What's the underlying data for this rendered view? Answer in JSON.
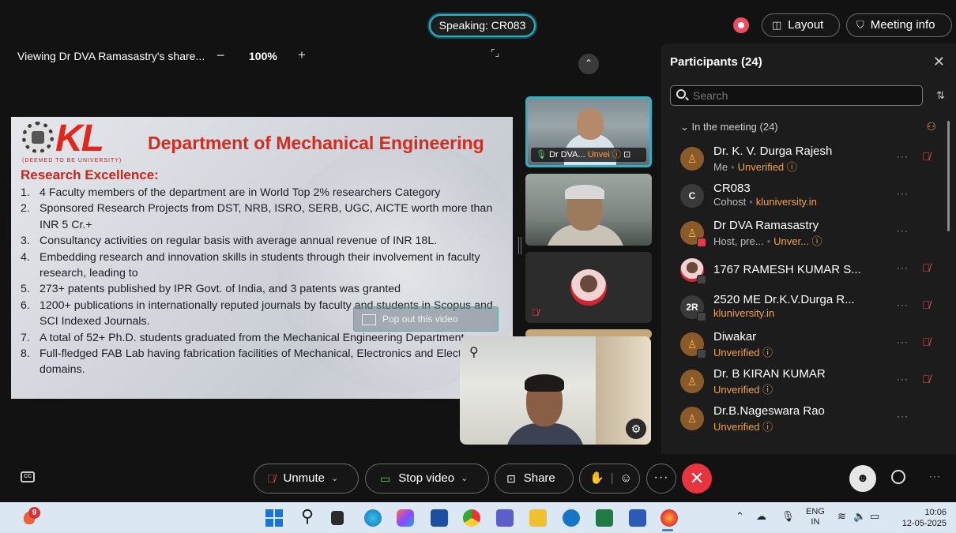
{
  "top": {
    "speaking": "Speaking: CR083",
    "layout_label": "Layout",
    "meeting_info_label": "Meeting info"
  },
  "share_bar": {
    "viewing": "Viewing Dr DVA Ramasastry's share...",
    "zoom_out": "−",
    "zoom_level": "100%",
    "zoom_in": "+"
  },
  "slide": {
    "logo_text": "KL",
    "logo_university": "(DEEMED TO BE UNIVERSITY)",
    "title": "Department of Mechanical Engineering",
    "subtitle": "Research Excellence:",
    "items": [
      {
        "n": "1.",
        "text": "4 Faculty members of the department are in World Top 2% researchers Category"
      },
      {
        "n": "2.",
        "text": "Sponsored Research Projects from DST, NRB, ISRO, SERB, UGC, AICTE worth more than INR 5 Cr.+"
      },
      {
        "n": "3.",
        "text": "Consultancy activities on regular basis with average annual revenue of INR 18L."
      },
      {
        "n": "4.",
        "text": "Embedding research and innovation skills in students through their involvement in faculty research, leading to"
      },
      {
        "n": "5.",
        "text": "273+ patents published by IPR Govt. of India, and 3 patents was granted"
      },
      {
        "n": "6.",
        "text": "1200+ publications in internationally reputed journals by faculty and students in Scopus and SCI Indexed Journals."
      },
      {
        "n": "7.",
        "text": "A total of 52+ Ph.D. students graduated from the Mechanical Engineering Department."
      },
      {
        "n": "8.",
        "text": "Full-fledged FAB Lab having fabrication facilities of Mechanical, Electronics and Electrical domains."
      }
    ],
    "popout": "Pop out this video"
  },
  "tiles": {
    "tile1_name": "Dr DVA...",
    "tile1_status": "Unvei"
  },
  "panel": {
    "title": "Participants (24)",
    "search_placeholder": "Search",
    "in_meeting": "In the meeting (24)",
    "participants": [
      {
        "name": "Dr. K. V. Durga Rajesh",
        "role": "Me",
        "status": "Unverified ⓘ",
        "initials": "",
        "muted": true
      },
      {
        "name": "CR083",
        "role": "Cohost",
        "status": "kluniversity.in",
        "initials": "C",
        "muted": false
      },
      {
        "name": "Dr DVA Ramasastry",
        "role": "Host, pre...",
        "status": "Unver... ⓘ",
        "initials": "",
        "muted": false
      },
      {
        "name": "1767 RAMESH KUMAR S...",
        "role": "",
        "status": "",
        "initials": "",
        "muted": true
      },
      {
        "name": "2520 ME Dr.K.V.Durga R...",
        "role": "",
        "status": "kluniversity.in",
        "initials": "2R",
        "muted": true
      },
      {
        "name": "Diwakar",
        "role": "",
        "status": "Unverified ⓘ",
        "initials": "",
        "muted": true
      },
      {
        "name": "Dr. B KIRAN KUMAR",
        "role": "",
        "status": "Unverified ⓘ",
        "initials": "",
        "muted": true
      },
      {
        "name": "Dr.B.Nageswara Rao",
        "role": "",
        "status": "Unverified ⓘ",
        "initials": "",
        "muted": false
      }
    ]
  },
  "controls": {
    "unmute": "Unmute",
    "stop_video": "Stop video",
    "share": "Share"
  },
  "taskbar": {
    "notification_count": "9",
    "lang_top": "ENG",
    "lang_bottom": "IN",
    "time": "10:06",
    "date": "12-05-2025"
  },
  "colors": {
    "accent_teal": "#2fb0c6",
    "unverified_orange": "#f0a34a",
    "leave_red": "#e8343e",
    "slide_title_red": "#d42a1f"
  }
}
